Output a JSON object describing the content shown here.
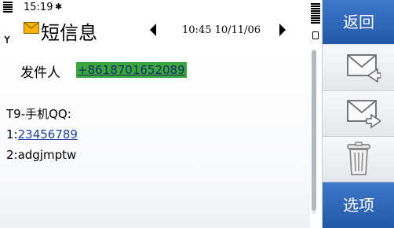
{
  "status": {
    "time": "15:19",
    "bluetooth_glyph": "✱"
  },
  "title": {
    "text": "短信息",
    "icon": "envelope-icon",
    "datetime": "10:45 10/11/06"
  },
  "message": {
    "sender_label": "发件人",
    "sender_number": "+8618701652089",
    "line1": "T9-手机QQ:",
    "line2_prefix": "1:",
    "line2_link": "23456789",
    "line3": "2:adgjmptw"
  },
  "softkeys": {
    "back_label": "返回",
    "options_label": "选项",
    "reply_icon": "reply-envelope-icon",
    "forward_icon": "forward-envelope-icon",
    "delete_icon": "trash-icon"
  },
  "colors": {
    "softkey_blue": "#2f68b8",
    "sender_highlight": "#3aa83a",
    "link": "#1a3f9e"
  }
}
